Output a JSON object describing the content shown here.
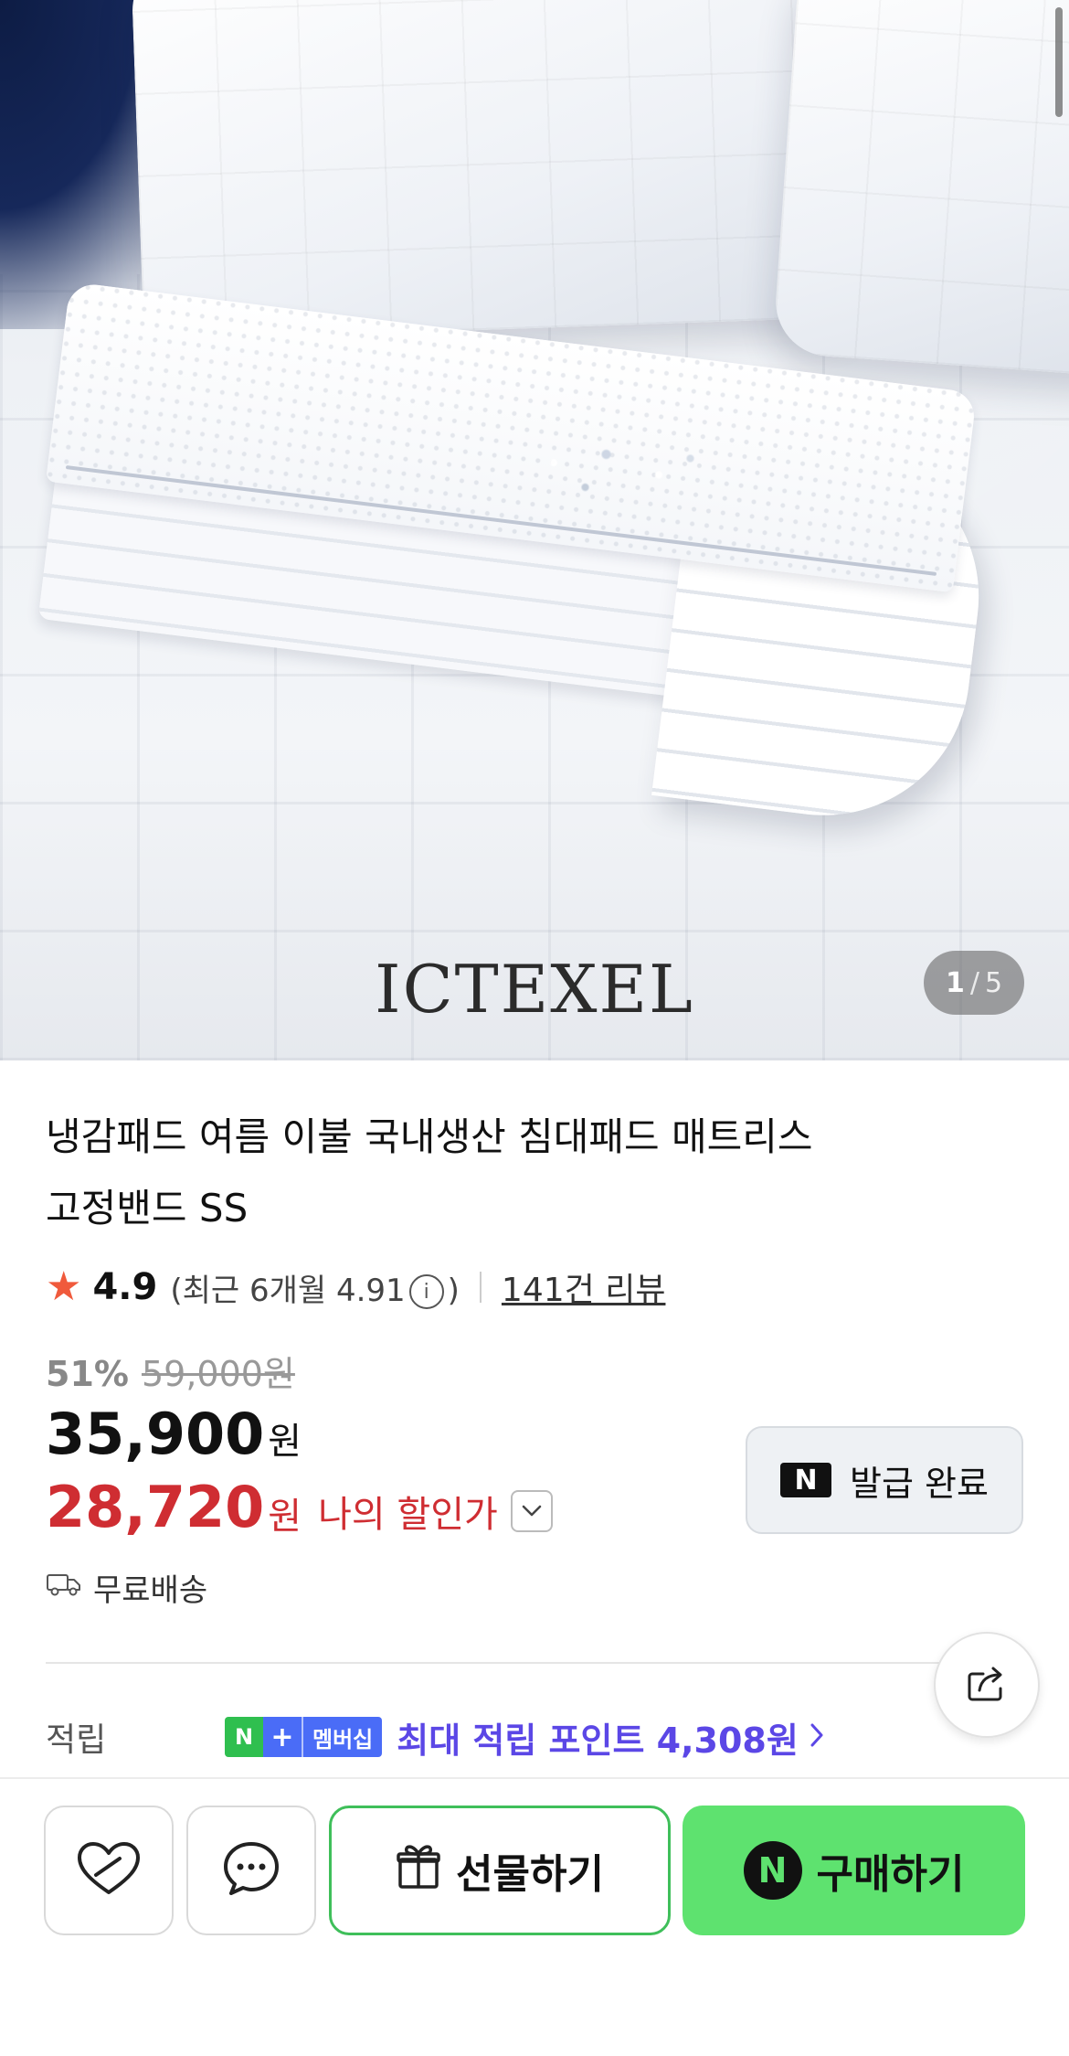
{
  "hero": {
    "logo_text": "ICTEXEL",
    "counter": {
      "current": "1",
      "separator": "/",
      "total": "5"
    }
  },
  "product": {
    "title_line1": "냉감패드 여름 이불 국내생산 침대패드 매트리스",
    "title_line2": "고정밴드 SS",
    "rating": "4.9",
    "recent_open": "(최근 6개월 4.91",
    "recent_close": ")",
    "review_link": "141건 리뷰",
    "discount_rate": "51%",
    "original_price": "59,000원",
    "price": "35,900",
    "price_unit": "원",
    "my_price": "28,720",
    "my_price_unit": "원",
    "my_price_label": "나의 할인가",
    "coupon_badge": "N",
    "coupon_label": "발급 완료",
    "shipping": "무료배송"
  },
  "points": {
    "label": "적립",
    "badge_n": "N",
    "badge_plus": "+",
    "badge_member": "멤버십",
    "text": "최대 적립 포인트 4,308원"
  },
  "actions": {
    "gift_label": "선물하기",
    "buy_badge": "N",
    "buy_label": "구매하기"
  },
  "icons": [
    "star-icon",
    "info-icon",
    "chevron-down-icon",
    "truck-icon",
    "share-icon",
    "chevron-right-icon",
    "heart-icon",
    "chat-icon",
    "gift-icon"
  ],
  "colors": {
    "rating_star": "#f05a3c",
    "my_price": "#cf2d32",
    "points": "#5b47e6",
    "buy_button": "#5ee26f",
    "gift_border": "#3fbf5a"
  }
}
